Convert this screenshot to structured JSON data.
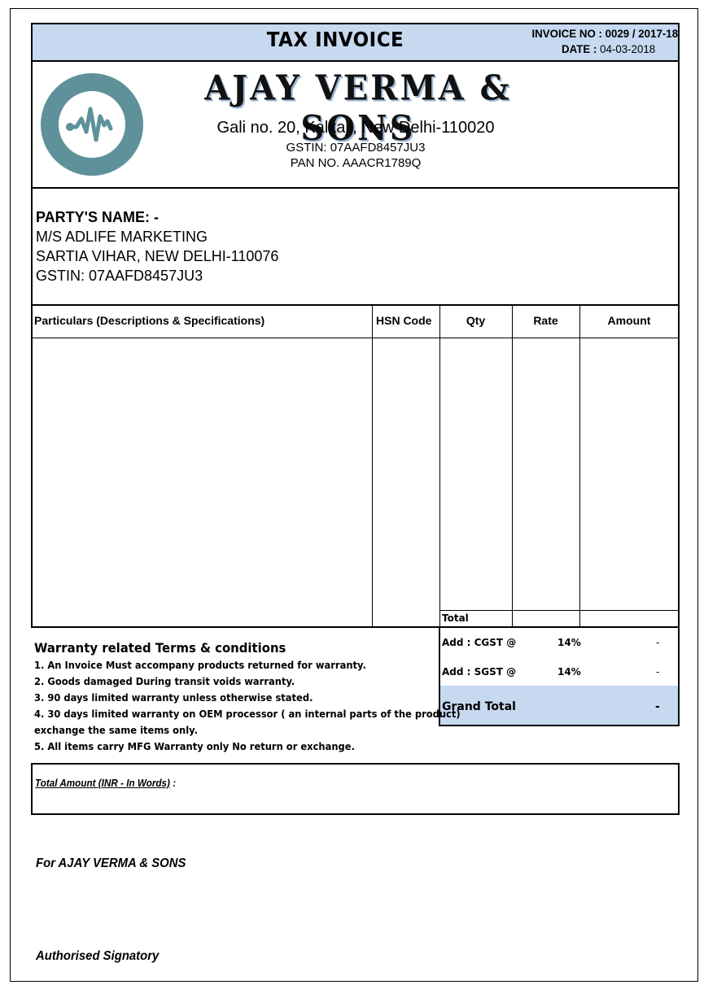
{
  "header": {
    "title": "TAX INVOICE",
    "invoice_no_label": "INVOICE NO :",
    "invoice_no": "0029 / 2017-18",
    "date_label": "DATE :",
    "date": "04-03-2018",
    "bar_color": "#c6d9f1"
  },
  "company": {
    "logo_icon": "heartbeat-circle-icon",
    "logo_color": "#5e9199",
    "name": "AJAY VERMA & SONS",
    "address": "Gali no. 20, Kalkaji, New Delhi-110020",
    "gstin": "GSTIN: 07AAFD8457JU3",
    "pan": "PAN NO. AAACR1789Q"
  },
  "party": {
    "label": "PARTY'S NAME: -",
    "lines": [
      "M/S ADLIFE MARKETING",
      "SARTIA VIHAR, NEW DELHI-110076",
      "GSTIN: 07AAFD8457JU3"
    ]
  },
  "items_table": {
    "columns": [
      "Particulars (Descriptions & Specifications)",
      "HSN Code",
      "Qty",
      "Rate",
      "Amount"
    ],
    "rows": [],
    "total_label": "Total",
    "total_value": ""
  },
  "taxes": {
    "cgst_label": "Add : CGST @",
    "cgst_rate": "14%",
    "cgst_value": "-",
    "sgst_label": "Add : SGST @",
    "sgst_rate": "14%",
    "sgst_value": "-",
    "grand_total_label": "Grand Total",
    "grand_total_value": "-"
  },
  "terms": {
    "title": "Warranty related Terms & conditions",
    "items": [
      "1. An Invoice Must accompany products returned for warranty.",
      "2. Goods damaged During transit voids warranty.",
      "3. 90 days limited warranty unless otherwise stated.",
      "4. 30 days limited warranty on OEM processor ( an internal parts of the product)",
      "exchange the same items only.",
      "5. All items carry MFG Warranty only No return or exchange."
    ]
  },
  "amount_words": {
    "label": "Total Amount (INR - In Words)",
    "suffix": ":",
    "value": ""
  },
  "footer": {
    "for_company": "For AJAY VERMA & SONS",
    "signatory": "Authorised Signatory"
  }
}
